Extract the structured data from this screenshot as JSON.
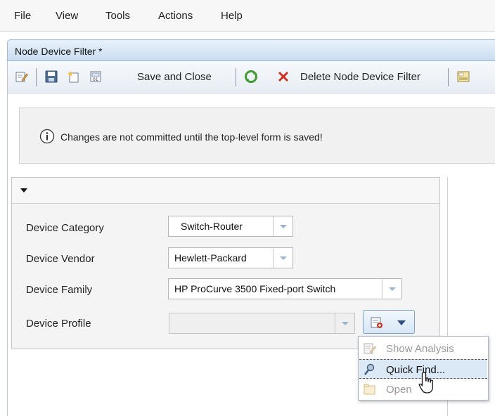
{
  "menubar": {
    "items": [
      "File",
      "View",
      "Tools",
      "Actions",
      "Help"
    ]
  },
  "tab": {
    "title": "Node Device Filter *"
  },
  "toolbar": {
    "save_and_close_label": "Save and Close",
    "delete_label": "Delete Node Device Filter",
    "icons": [
      "edit-icon",
      "save-icon",
      "new-icon",
      "save-close-icon",
      "refresh-icon",
      "delete-icon",
      "report-icon"
    ]
  },
  "info": {
    "message": "Changes are not committed until the top-level form is saved!",
    "icon": "info-icon"
  },
  "form": {
    "fields": [
      {
        "label": "Device Category",
        "value": "Switch-Router"
      },
      {
        "label": "Device Vendor",
        "value": "Hewlett-Packard"
      },
      {
        "label": "Device Family",
        "value": "HP ProCurve 3500 Fixed-port Switch"
      },
      {
        "label": "Device Profile",
        "value": ""
      }
    ]
  },
  "dropdown": {
    "items": [
      {
        "label": "Show Analysis",
        "enabled": false,
        "icon": "analysis-icon"
      },
      {
        "label": "Quick Find...",
        "enabled": true,
        "icon": "quick-find-icon",
        "highlighted": true
      },
      {
        "label": "Open",
        "enabled": false,
        "icon": "open-icon"
      }
    ]
  },
  "colors": {
    "tab_gradient_top": "#e9f2fb",
    "tab_gradient_bottom": "#c9ddf1",
    "delete_red": "#d42a1a",
    "refresh_green": "#3f9a2f",
    "highlight": "#dbe8f6"
  }
}
